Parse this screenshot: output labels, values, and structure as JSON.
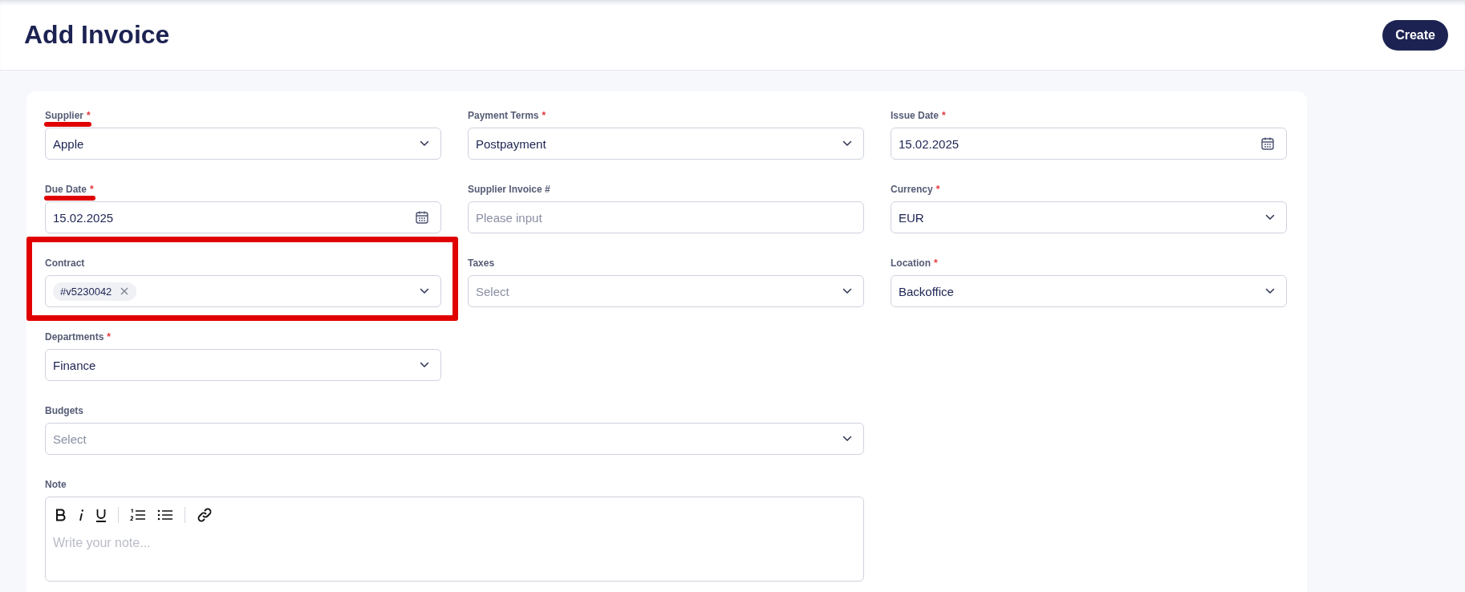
{
  "header": {
    "title": "Add Invoice",
    "create_button": "Create"
  },
  "fields": [
    {
      "kind": "select",
      "label": "Supplier",
      "asterisk": "*",
      "value": "Apple",
      "underlined": true
    },
    {
      "kind": "select",
      "label": "Payment Terms",
      "asterisk": "*",
      "value": "Postpayment"
    },
    {
      "kind": "date",
      "label": "Issue Date",
      "asterisk": "*",
      "value": "15.02.2025"
    },
    {
      "kind": "date",
      "label": "Due Date",
      "asterisk": "*",
      "value": "15.02.2025",
      "underlined": true
    },
    {
      "kind": "input",
      "label": "Supplier Invoice #",
      "placeholder": "Please input"
    },
    {
      "kind": "select",
      "label": "Currency",
      "asterisk": "*",
      "value": "EUR"
    },
    {
      "kind": "multiselect",
      "label": "Contract",
      "tags": [
        "#v5230042"
      ],
      "framed": true
    },
    {
      "kind": "select",
      "label": "Taxes",
      "placeholder": "Select"
    },
    {
      "kind": "select",
      "label": "Location",
      "asterisk": "*",
      "value": "Backoffice"
    },
    {
      "kind": "select",
      "label": "Departments",
      "asterisk": "*",
      "value": "Finance"
    },
    {
      "kind": "select",
      "label": "Budgets",
      "placeholder": "Select",
      "wide": true
    },
    {
      "kind": "editor",
      "label": "Note",
      "placeholder": "Write your note...",
      "wide": true
    }
  ]
}
